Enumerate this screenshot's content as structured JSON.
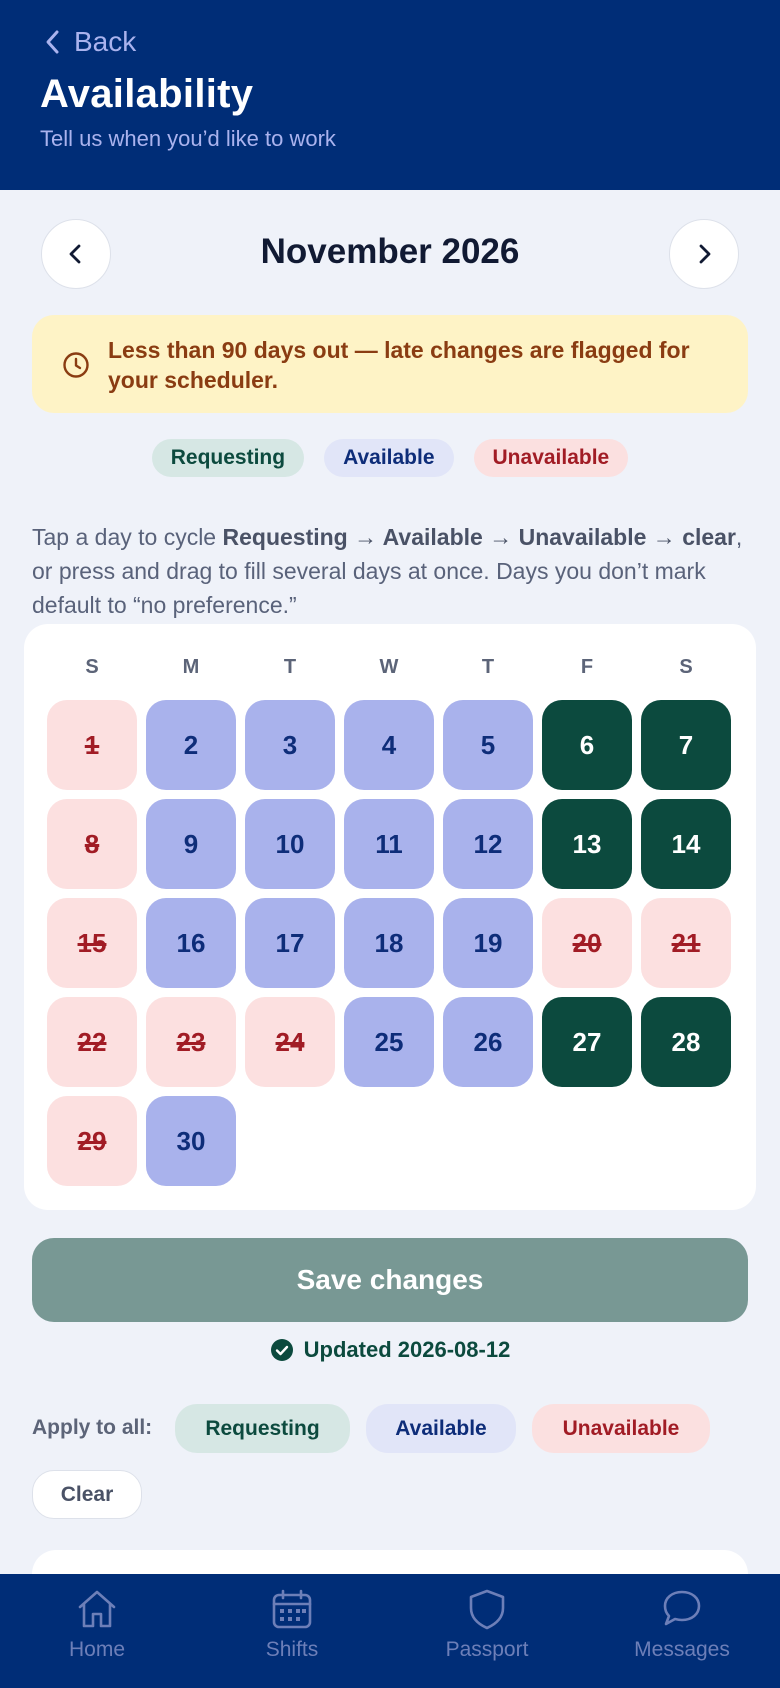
{
  "header": {
    "back_label": "Back",
    "title": "Availability",
    "subtitle": "Tell us when you’d like to work"
  },
  "calendar": {
    "month_label": "November 2026",
    "weekdays": [
      "S",
      "M",
      "T",
      "W",
      "T",
      "F",
      "S"
    ],
    "days": [
      {
        "n": "1",
        "state": "unavailable"
      },
      {
        "n": "2",
        "state": "available"
      },
      {
        "n": "3",
        "state": "available"
      },
      {
        "n": "4",
        "state": "available"
      },
      {
        "n": "5",
        "state": "available"
      },
      {
        "n": "6",
        "state": "requesting"
      },
      {
        "n": "7",
        "state": "requesting"
      },
      {
        "n": "8",
        "state": "unavailable"
      },
      {
        "n": "9",
        "state": "available"
      },
      {
        "n": "10",
        "state": "available"
      },
      {
        "n": "11",
        "state": "available"
      },
      {
        "n": "12",
        "state": "available"
      },
      {
        "n": "13",
        "state": "requesting"
      },
      {
        "n": "14",
        "state": "requesting"
      },
      {
        "n": "15",
        "state": "unavailable"
      },
      {
        "n": "16",
        "state": "available"
      },
      {
        "n": "17",
        "state": "available"
      },
      {
        "n": "18",
        "state": "available"
      },
      {
        "n": "19",
        "state": "available"
      },
      {
        "n": "20",
        "state": "unavailable"
      },
      {
        "n": "21",
        "state": "unavailable"
      },
      {
        "n": "22",
        "state": "unavailable"
      },
      {
        "n": "23",
        "state": "unavailable"
      },
      {
        "n": "24",
        "state": "unavailable"
      },
      {
        "n": "25",
        "state": "available"
      },
      {
        "n": "26",
        "state": "available"
      },
      {
        "n": "27",
        "state": "requesting"
      },
      {
        "n": "28",
        "state": "requesting"
      },
      {
        "n": "29",
        "state": "unavailable"
      },
      {
        "n": "30",
        "state": "available"
      }
    ]
  },
  "warning": {
    "icon": "clock-icon",
    "text": "Less than 90 days out — late changes are flagged for your scheduler."
  },
  "legend": {
    "requesting": "Requesting",
    "available": "Available",
    "unavailable": "Unavailable"
  },
  "instructions": {
    "part1": "Tap a day to cycle ",
    "bold": "Requesting → Available → Unavailable → clear",
    "part2": ", or press and drag to fill several days at once. Days you don’t mark default to “no preference.”"
  },
  "actions": {
    "save_label": "Save changes",
    "updated_text": "Updated 2026-08-12",
    "apply_label": "Apply to all:",
    "apply_requesting": "Requesting",
    "apply_available": "Available",
    "apply_unavailable": "Unavailable",
    "clear_label": "Clear"
  },
  "colors": {
    "header_bg": "#002d77",
    "requesting": "#0c4a3e",
    "available": "#a9b2ec",
    "unavailable": "#fce0e0",
    "warning_bg": "#fef3c6"
  },
  "bottom_nav": {
    "items": [
      {
        "label": "Home",
        "icon": "home-icon"
      },
      {
        "label": "Shifts",
        "icon": "calendar-icon"
      },
      {
        "label": "Passport",
        "icon": "shield-icon"
      },
      {
        "label": "Messages",
        "icon": "chat-icon"
      }
    ]
  }
}
